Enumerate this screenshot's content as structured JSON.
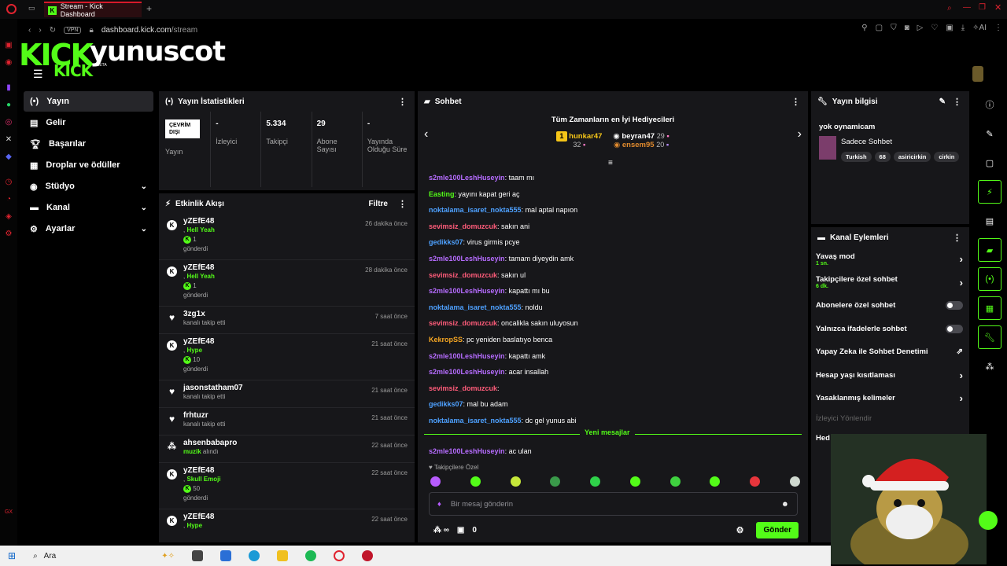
{
  "browser": {
    "tab_title": "Stream - Kick Dashboard",
    "new_tab": "+",
    "vpn_label": "VPN",
    "url_domain": "dashboard.kick.com",
    "url_path": "/stream",
    "ai_label": "AI"
  },
  "brand": {
    "logo": "KICK",
    "logo_small": "KICK",
    "beta": "BETA",
    "username": "yunuscot"
  },
  "nav": {
    "items": [
      {
        "label": "Yayın",
        "icon": "broadcast-icon"
      },
      {
        "label": "Gelir",
        "icon": "wallet-icon"
      },
      {
        "label": "Başarılar",
        "icon": "trophy-icon"
      },
      {
        "label": "Droplar ve ödüller",
        "icon": "gift-icon"
      },
      {
        "label": "Stüdyo",
        "icon": "studio-icon"
      },
      {
        "label": "Kanal",
        "icon": "channel-icon"
      },
      {
        "label": "Ayarlar",
        "icon": "gear-icon"
      }
    ]
  },
  "stats": {
    "title": "Yayın İstatistikleri",
    "offline_badge": "ÇEVRİM DIŞI",
    "offline_label": "Yayın",
    "items": [
      {
        "value": "-",
        "label": "İzleyici"
      },
      {
        "value": "5.334",
        "label": "Takipçi"
      },
      {
        "value": "29",
        "label": "Abone Sayısı"
      },
      {
        "value": "-",
        "label": "Yayında Olduğu Süre"
      }
    ]
  },
  "feed": {
    "title": "Etkinlik Akışı",
    "filter": "Filtre",
    "items": [
      {
        "name": "yZEfE48",
        "time": "26 dakika önce",
        "detail": "Hell Yeah",
        "amount": "1",
        "action": "gönderdi",
        "type": "kick"
      },
      {
        "name": "yZEfE48",
        "time": "28 dakika önce",
        "detail": "Hell Yeah",
        "amount": "1",
        "action": "gönderdi",
        "type": "kick"
      },
      {
        "name": "3zg1x",
        "time": "7 saat önce",
        "action": "kanalı takip etti",
        "type": "follow"
      },
      {
        "name": "yZEfE48",
        "time": "21 saat önce",
        "detail": "Hype",
        "amount": "10",
        "action": "gönderdi",
        "type": "kick"
      },
      {
        "name": "jasonstatham07",
        "time": "21 saat önce",
        "action": "kanalı takip etti",
        "type": "follow"
      },
      {
        "name": "frhtuzr",
        "time": "21 saat önce",
        "action": "kanalı takip etti",
        "type": "follow"
      },
      {
        "name": "ahsenbabapro",
        "time": "22 saat önce",
        "detail": "muzik",
        "action": "alındı",
        "type": "reward"
      },
      {
        "name": "yZEfE48",
        "time": "22 saat önce",
        "detail": "Skull Emoji",
        "amount": "50",
        "action": "gönderdi",
        "type": "kick"
      },
      {
        "name": "yZEfE48",
        "time": "22 saat önce",
        "detail": "Hype",
        "type": "kick"
      }
    ]
  },
  "chat": {
    "title": "Sohbet",
    "gifters_title": "Tüm Zamanların en İyi Hediyecileri",
    "gifters": [
      {
        "rank": "1",
        "name": "hunkar47",
        "count": "32"
      },
      {
        "name": "beyran47",
        "count": "29"
      },
      {
        "name": "ensem95",
        "count": "20"
      }
    ],
    "messages": [
      {
        "user": "s2mle100LeshHuseyin",
        "color": "#b66cff",
        "text": ": taam mı"
      },
      {
        "user": "Easting",
        "color": "#53fc18",
        "text": ": yayını kapat geri aç"
      },
      {
        "user": "noktalama_isaret_nokta555",
        "color": "#4ea1ff",
        "text": ": mal aptal napıon"
      },
      {
        "user": "sevimsiz_domuzcuk",
        "color": "#ff5c7a",
        "text": ": sakın ani"
      },
      {
        "user": "gedikks07",
        "color": "#4ea1ff",
        "text": ": virus girmis pcye"
      },
      {
        "user": "s2mle100LeshHuseyin",
        "color": "#b66cff",
        "text": ": tamam diyeydin amk"
      },
      {
        "user": "sevimsiz_domuzcuk",
        "color": "#ff5c7a",
        "text": ": sakın ul"
      },
      {
        "user": "s2mle100LeshHuseyin",
        "color": "#b66cff",
        "text": ": kapattı mı bu"
      },
      {
        "user": "noktalama_isaret_nokta555",
        "color": "#4ea1ff",
        "text": ": noldu"
      },
      {
        "user": "sevimsiz_domuzcuk",
        "color": "#ff5c7a",
        "text": ": oncalikla sakın uluyosun"
      },
      {
        "user": "KekropSS",
        "color": "#f5a623",
        "text": ": pc yeniden baslatıyo benca"
      },
      {
        "user": "s2mle100LeshHuseyin",
        "color": "#b66cff",
        "text": ": kapattı amk"
      },
      {
        "user": "s2mle100LeshHuseyin",
        "color": "#b66cff",
        "text": ": acar insallah"
      },
      {
        "user": "sevimsiz_domuzcuk",
        "color": "#ff5c7a",
        "text": ":"
      },
      {
        "user": "gedikks07",
        "color": "#4ea1ff",
        "text": ": mal bu adam"
      },
      {
        "user": "noktalama_isaret_nokta555",
        "color": "#4ea1ff",
        "text": ": dc gel yunus abi"
      }
    ],
    "new_messages": "Yeni mesajlar",
    "last_message": {
      "user": "s2mle100LeshHuseyin",
      "color": "#b66cff",
      "text": ": ac ulan"
    },
    "followers_only": "Takipçilere Özel",
    "input_placeholder": "Bir mesaj gönderin",
    "gift_count": "0",
    "send": "Gönder"
  },
  "info": {
    "title": "Yayın bilgisi",
    "stream_title": "yok oynamicam",
    "category": "Sadece Sohbet",
    "tags": [
      "Turkish",
      "68",
      "asiricirkin",
      "cirkin"
    ]
  },
  "actions": {
    "title": "Kanal Eylemleri",
    "items": [
      {
        "label": "Yavaş mod",
        "sub": "1 sn.",
        "control": "chevron"
      },
      {
        "label": "Takipçilere özel sohbet",
        "sub": "6 dk.",
        "control": "chevron"
      },
      {
        "label": "Abonelere özel sohbet",
        "control": "toggle"
      },
      {
        "label": "Yalnızca ifadelerle sohbet",
        "control": "toggle"
      },
      {
        "label": "Yapay Zeka ile Sohbet Denetimi",
        "control": "external"
      },
      {
        "label": "Hesap yaşı kısıtlaması",
        "control": "chevron"
      },
      {
        "label": "Yasaklanmış kelimeler",
        "control": "chevron"
      }
    ],
    "viewer_direct": "İzleyici Yönlendir",
    "partial": "Hed"
  },
  "taskbar": {
    "search": "Ara"
  },
  "colors": {
    "accent": "#53fc18",
    "panel": "#17171a",
    "background": "#000000"
  }
}
